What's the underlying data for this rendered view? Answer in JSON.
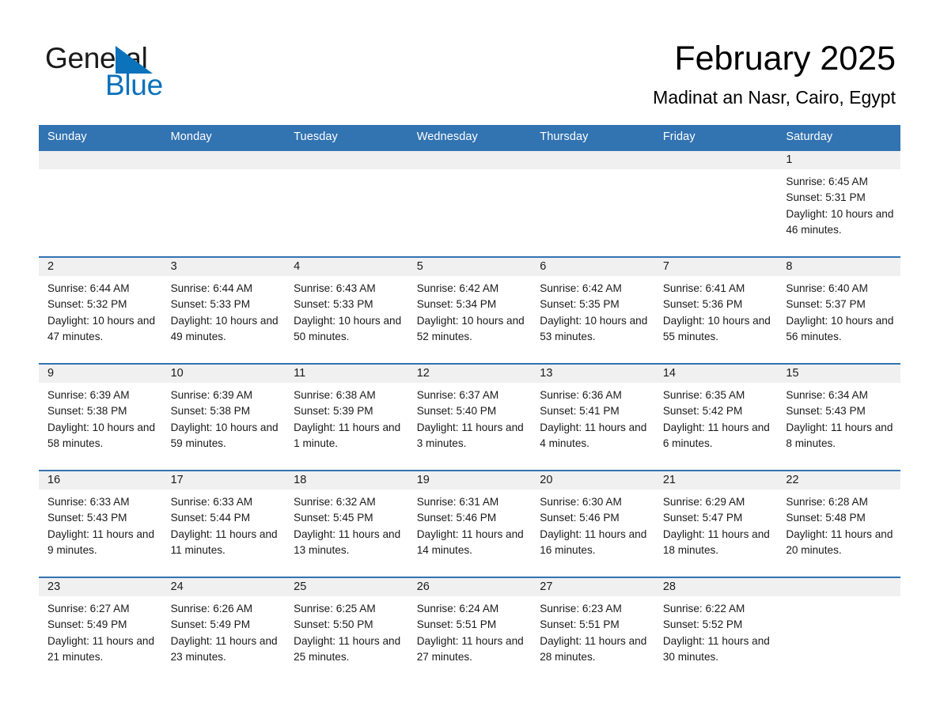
{
  "brand": {
    "word1": "General",
    "word2": "Blue",
    "triangle_color": "#0b72bb",
    "text_color": "#1a1a1a"
  },
  "header": {
    "month_title": "February 2025",
    "location": "Madinat an Nasr, Cairo, Egypt"
  },
  "theme": {
    "header_blue": "#3273b1",
    "row_rule_blue": "#3273b1",
    "daynum_band": "#f0f0f0",
    "text": "#1a1a1a"
  },
  "weekdays": [
    "Sunday",
    "Monday",
    "Tuesday",
    "Wednesday",
    "Thursday",
    "Friday",
    "Saturday"
  ],
  "weeks": [
    [
      {
        "day": "",
        "sunrise": "",
        "sunset": "",
        "daylight": ""
      },
      {
        "day": "",
        "sunrise": "",
        "sunset": "",
        "daylight": ""
      },
      {
        "day": "",
        "sunrise": "",
        "sunset": "",
        "daylight": ""
      },
      {
        "day": "",
        "sunrise": "",
        "sunset": "",
        "daylight": ""
      },
      {
        "day": "",
        "sunrise": "",
        "sunset": "",
        "daylight": ""
      },
      {
        "day": "",
        "sunrise": "",
        "sunset": "",
        "daylight": ""
      },
      {
        "day": "1",
        "sunrise": "Sunrise: 6:45 AM",
        "sunset": "Sunset: 5:31 PM",
        "daylight": "Daylight: 10 hours and 46 minutes."
      }
    ],
    [
      {
        "day": "2",
        "sunrise": "Sunrise: 6:44 AM",
        "sunset": "Sunset: 5:32 PM",
        "daylight": "Daylight: 10 hours and 47 minutes."
      },
      {
        "day": "3",
        "sunrise": "Sunrise: 6:44 AM",
        "sunset": "Sunset: 5:33 PM",
        "daylight": "Daylight: 10 hours and 49 minutes."
      },
      {
        "day": "4",
        "sunrise": "Sunrise: 6:43 AM",
        "sunset": "Sunset: 5:33 PM",
        "daylight": "Daylight: 10 hours and 50 minutes."
      },
      {
        "day": "5",
        "sunrise": "Sunrise: 6:42 AM",
        "sunset": "Sunset: 5:34 PM",
        "daylight": "Daylight: 10 hours and 52 minutes."
      },
      {
        "day": "6",
        "sunrise": "Sunrise: 6:42 AM",
        "sunset": "Sunset: 5:35 PM",
        "daylight": "Daylight: 10 hours and 53 minutes."
      },
      {
        "day": "7",
        "sunrise": "Sunrise: 6:41 AM",
        "sunset": "Sunset: 5:36 PM",
        "daylight": "Daylight: 10 hours and 55 minutes."
      },
      {
        "day": "8",
        "sunrise": "Sunrise: 6:40 AM",
        "sunset": "Sunset: 5:37 PM",
        "daylight": "Daylight: 10 hours and 56 minutes."
      }
    ],
    [
      {
        "day": "9",
        "sunrise": "Sunrise: 6:39 AM",
        "sunset": "Sunset: 5:38 PM",
        "daylight": "Daylight: 10 hours and 58 minutes."
      },
      {
        "day": "10",
        "sunrise": "Sunrise: 6:39 AM",
        "sunset": "Sunset: 5:38 PM",
        "daylight": "Daylight: 10 hours and 59 minutes."
      },
      {
        "day": "11",
        "sunrise": "Sunrise: 6:38 AM",
        "sunset": "Sunset: 5:39 PM",
        "daylight": "Daylight: 11 hours and 1 minute."
      },
      {
        "day": "12",
        "sunrise": "Sunrise: 6:37 AM",
        "sunset": "Sunset: 5:40 PM",
        "daylight": "Daylight: 11 hours and 3 minutes."
      },
      {
        "day": "13",
        "sunrise": "Sunrise: 6:36 AM",
        "sunset": "Sunset: 5:41 PM",
        "daylight": "Daylight: 11 hours and 4 minutes."
      },
      {
        "day": "14",
        "sunrise": "Sunrise: 6:35 AM",
        "sunset": "Sunset: 5:42 PM",
        "daylight": "Daylight: 11 hours and 6 minutes."
      },
      {
        "day": "15",
        "sunrise": "Sunrise: 6:34 AM",
        "sunset": "Sunset: 5:43 PM",
        "daylight": "Daylight: 11 hours and 8 minutes."
      }
    ],
    [
      {
        "day": "16",
        "sunrise": "Sunrise: 6:33 AM",
        "sunset": "Sunset: 5:43 PM",
        "daylight": "Daylight: 11 hours and 9 minutes."
      },
      {
        "day": "17",
        "sunrise": "Sunrise: 6:33 AM",
        "sunset": "Sunset: 5:44 PM",
        "daylight": "Daylight: 11 hours and 11 minutes."
      },
      {
        "day": "18",
        "sunrise": "Sunrise: 6:32 AM",
        "sunset": "Sunset: 5:45 PM",
        "daylight": "Daylight: 11 hours and 13 minutes."
      },
      {
        "day": "19",
        "sunrise": "Sunrise: 6:31 AM",
        "sunset": "Sunset: 5:46 PM",
        "daylight": "Daylight: 11 hours and 14 minutes."
      },
      {
        "day": "20",
        "sunrise": "Sunrise: 6:30 AM",
        "sunset": "Sunset: 5:46 PM",
        "daylight": "Daylight: 11 hours and 16 minutes."
      },
      {
        "day": "21",
        "sunrise": "Sunrise: 6:29 AM",
        "sunset": "Sunset: 5:47 PM",
        "daylight": "Daylight: 11 hours and 18 minutes."
      },
      {
        "day": "22",
        "sunrise": "Sunrise: 6:28 AM",
        "sunset": "Sunset: 5:48 PM",
        "daylight": "Daylight: 11 hours and 20 minutes."
      }
    ],
    [
      {
        "day": "23",
        "sunrise": "Sunrise: 6:27 AM",
        "sunset": "Sunset: 5:49 PM",
        "daylight": "Daylight: 11 hours and 21 minutes."
      },
      {
        "day": "24",
        "sunrise": "Sunrise: 6:26 AM",
        "sunset": "Sunset: 5:49 PM",
        "daylight": "Daylight: 11 hours and 23 minutes."
      },
      {
        "day": "25",
        "sunrise": "Sunrise: 6:25 AM",
        "sunset": "Sunset: 5:50 PM",
        "daylight": "Daylight: 11 hours and 25 minutes."
      },
      {
        "day": "26",
        "sunrise": "Sunrise: 6:24 AM",
        "sunset": "Sunset: 5:51 PM",
        "daylight": "Daylight: 11 hours and 27 minutes."
      },
      {
        "day": "27",
        "sunrise": "Sunrise: 6:23 AM",
        "sunset": "Sunset: 5:51 PM",
        "daylight": "Daylight: 11 hours and 28 minutes."
      },
      {
        "day": "28",
        "sunrise": "Sunrise: 6:22 AM",
        "sunset": "Sunset: 5:52 PM",
        "daylight": "Daylight: 11 hours and 30 minutes."
      },
      {
        "day": "",
        "sunrise": "",
        "sunset": "",
        "daylight": ""
      }
    ]
  ]
}
